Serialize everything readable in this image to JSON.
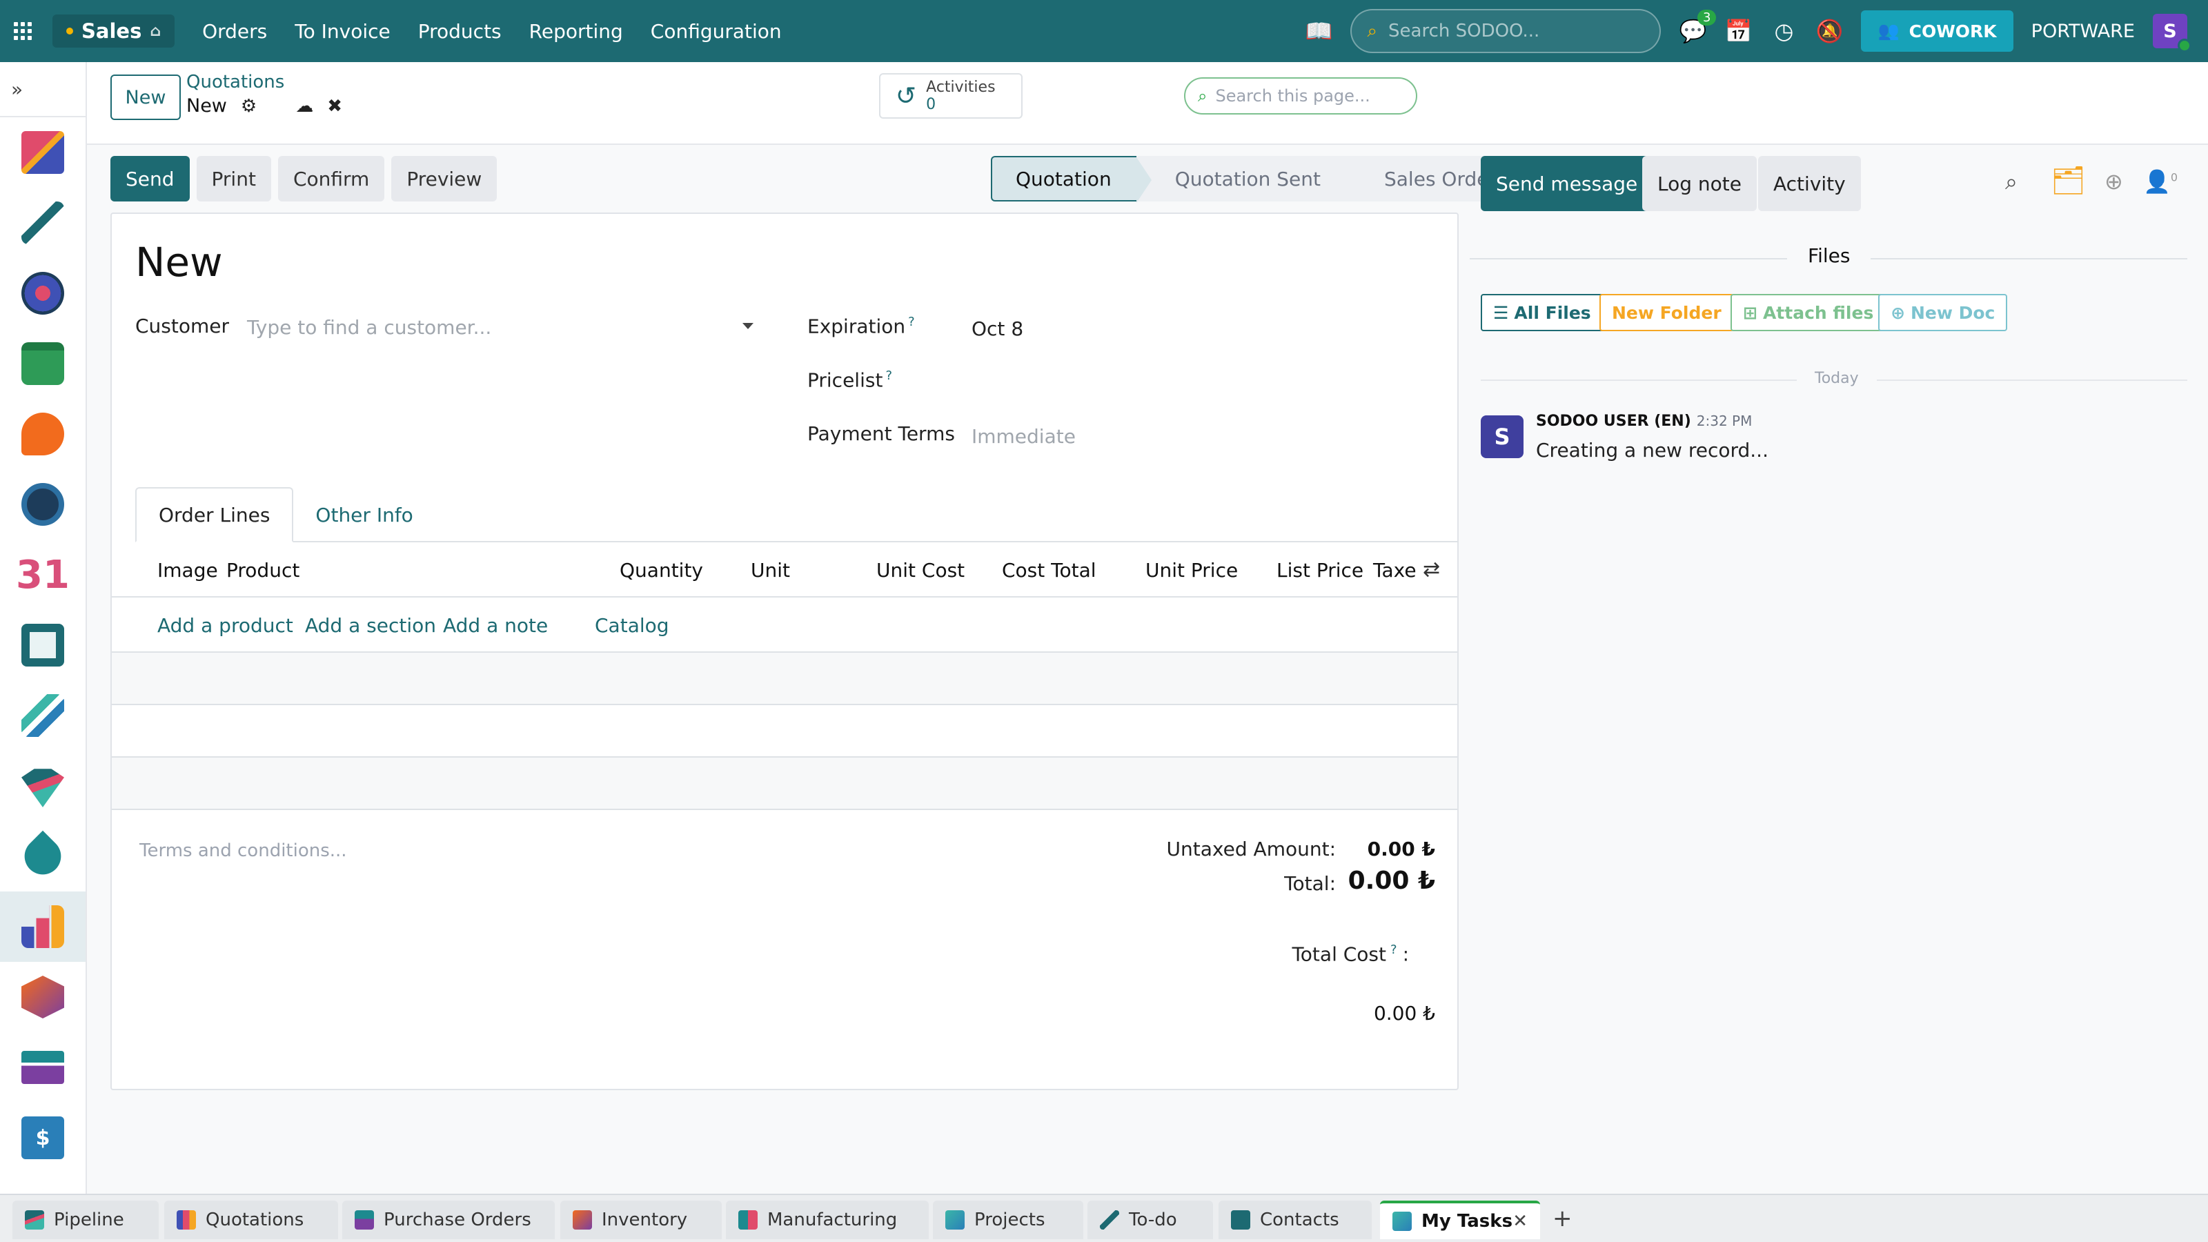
{
  "topbar": {
    "app_name": "Sales",
    "menu": [
      "Orders",
      "To Invoice",
      "Products",
      "Reporting",
      "Configuration"
    ],
    "search_placeholder": "Search SODOO...",
    "messages_badge": "3",
    "cowork_label": "COWORK",
    "company": "PORTWARE",
    "user_initial": "S"
  },
  "control": {
    "new_label": "New",
    "breadcrumb_parent": "Quotations",
    "breadcrumb_current": "New",
    "activities_label": "Activities",
    "activities_count": "0",
    "page_search_placeholder": "Search this page..."
  },
  "actions": {
    "send": "Send",
    "print": "Print",
    "confirm": "Confirm",
    "preview": "Preview"
  },
  "status": [
    "Quotation",
    "Quotation Sent",
    "Sales Order"
  ],
  "form": {
    "title": "New",
    "customer_label": "Customer",
    "customer_placeholder": "Type to find a customer...",
    "expiration_label": "Expiration",
    "expiration_value": "Oct 8",
    "pricelist_label": "Pricelist",
    "payment_terms_label": "Payment Terms",
    "payment_terms_placeholder": "Immediate",
    "help_mark": "?",
    "tabs": [
      "Order Lines",
      "Other Info"
    ],
    "columns": [
      "Image",
      "Product",
      "Quantity",
      "Unit",
      "Unit Cost",
      "Cost Total",
      "Unit Price",
      "List Price",
      "Taxe"
    ],
    "add_links": [
      "Add a product",
      "Add a section",
      "Add a note",
      "Catalog"
    ],
    "terms_placeholder": "Terms and conditions...",
    "untaxed_label": "Untaxed Amount:",
    "untaxed_value": "0.00 ₺",
    "total_label": "Total:",
    "total_value": "0.00 ₺",
    "total_cost_label": "Total Cost",
    "total_cost_colon": ":",
    "total_cost_value": "0.00 ₺"
  },
  "chatter": {
    "send_message": "Send message",
    "log_note": "Log note",
    "activity": "Activity",
    "followers_count": "0",
    "files_title": "Files",
    "all_files": "All Files",
    "new_folder": "New Folder",
    "attach_files": "Attach files",
    "new_doc": "New Doc",
    "today": "Today",
    "message": {
      "initial": "S",
      "author": "SODOO USER (EN)",
      "time": "2:32 PM",
      "body": "Creating a new record..."
    }
  },
  "taskbar": [
    "Pipeline",
    "Quotations",
    "Purchase Orders",
    "Inventory",
    "Manufacturing",
    "Projects",
    "To-do",
    "Contacts",
    "My Tasks"
  ],
  "colors": {
    "brand": "#1d6a72",
    "accent_green": "#28a745",
    "cowork": "#17a2b8"
  }
}
